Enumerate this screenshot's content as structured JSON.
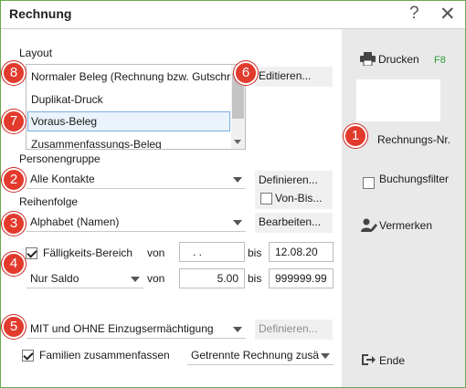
{
  "window": {
    "title": "Rechnung",
    "help_glyph": "?",
    "close_glyph": "✕"
  },
  "layout": {
    "label": "Layout",
    "items": [
      {
        "label": "Normaler Beleg (Rechnung bzw. Gutschrift"
      },
      {
        "label": "Duplikat-Druck"
      },
      {
        "label": "Voraus-Beleg",
        "selected": true
      },
      {
        "label": "Zusammenfassungs-Beleg"
      }
    ],
    "edit_button": "Editieren..."
  },
  "personengruppe": {
    "label": "Personengruppe",
    "value": "Alle Kontakte",
    "define_button": "Definieren...",
    "von_bis_label": "Von-Bis..."
  },
  "reihenfolge": {
    "label": "Reihenfolge",
    "value": "Alphabet (Namen)",
    "edit_button": "Bearbeiten..."
  },
  "faelligkeit": {
    "checkbox_label": "Fälligkeits-Bereich",
    "checked": true,
    "von_label": "von",
    "von_value": " .  .",
    "bis_label": "bis",
    "bis_value": "12.08.20"
  },
  "saldo": {
    "value": "Nur Saldo",
    "von_label": "von",
    "von_value": "5.00",
    "bis_label": "bis",
    "bis_value": "999999.99"
  },
  "einzug": {
    "value": "MIT und OHNE Einzugsermächtigung",
    "define_button": "Definieren..."
  },
  "familien": {
    "checkbox_label": "Familien zusammenfassen",
    "checked": true,
    "combo_value": "Getrennte Rechnung zusä"
  },
  "side": {
    "print_label": "Drucken",
    "print_key": "F8",
    "rechnungs_nr_label": "Rechnungs-Nr.",
    "buchungsfilter_label": "Buchungsfilter",
    "vermerken_label": "Vermerken",
    "ende_label": "Ende"
  },
  "badges": [
    "1",
    "2",
    "3",
    "4",
    "5",
    "6",
    "7",
    "8"
  ],
  "colors": {
    "badge": "#e23a2c",
    "fkey": "#2e9b3a",
    "frame": "#6aa84f",
    "selection": "#7aaee0"
  }
}
